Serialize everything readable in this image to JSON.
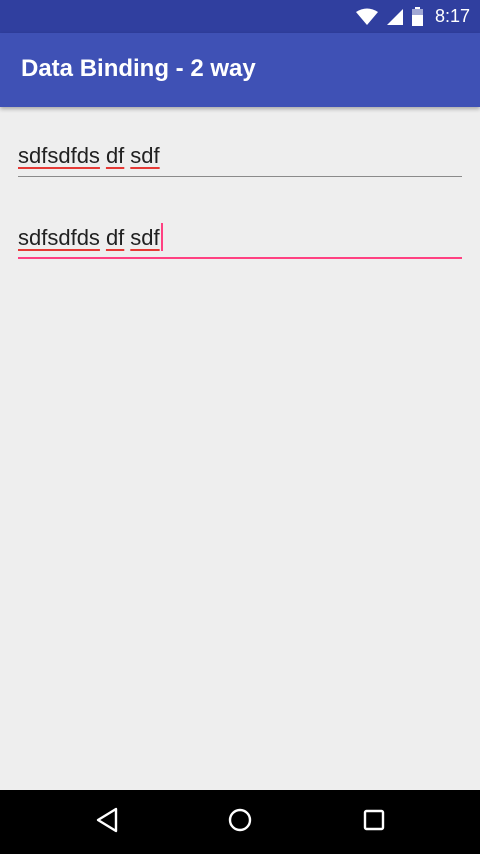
{
  "status_bar": {
    "time": "8:17",
    "icons": [
      "wifi-icon",
      "cellular-signal-icon",
      "battery-icon"
    ]
  },
  "app_bar": {
    "title": "Data Binding - 2 way"
  },
  "fields": [
    {
      "value": "sdfsdfds df sdf",
      "words": [
        "sdfsdfds",
        "df",
        "sdf"
      ],
      "focused": false
    },
    {
      "value": "sdfsdfds df sdf",
      "words": [
        "sdfsdfds",
        "df",
        "sdf"
      ],
      "focused": true
    }
  ],
  "nav_bar": {
    "buttons": [
      "back-icon",
      "home-icon",
      "recents-icon"
    ]
  },
  "colors": {
    "status_bar": "#303f9f",
    "primary": "#3f51b5",
    "accent": "#ff4081",
    "background": "#eeeeee",
    "spellcheck_underline": "#e53935"
  }
}
